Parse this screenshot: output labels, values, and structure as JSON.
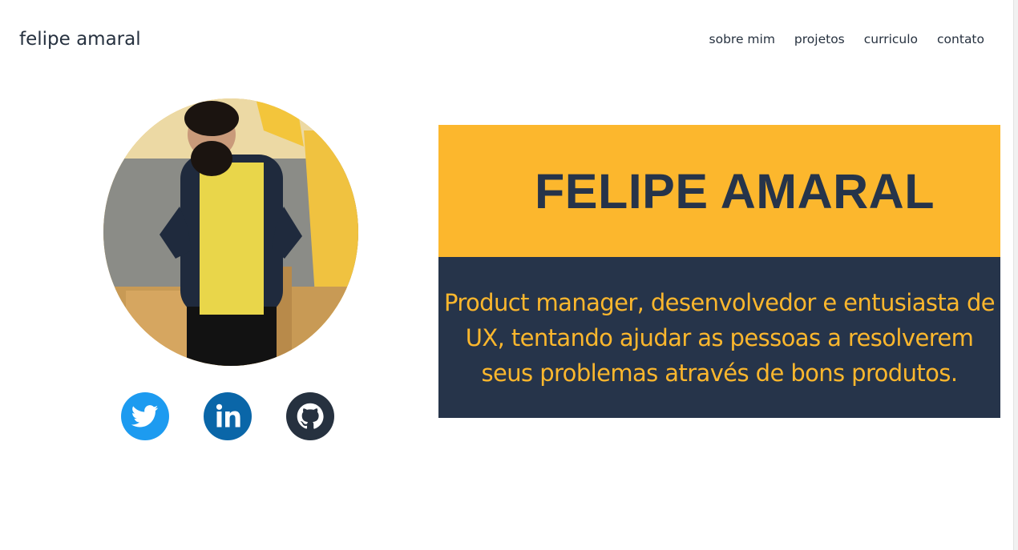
{
  "header": {
    "brand": "felipe amaral",
    "nav": [
      "sobre mim",
      "projetos",
      "curriculo",
      "contato"
    ]
  },
  "hero": {
    "name": "FELIPE AMARAL",
    "bio": "Product manager, desenvolvedor e entusiasta de UX, tentando ajudar as pessoas a resolverem seus problemas através de bons produtos."
  },
  "social": [
    {
      "name": "twitter",
      "icon": "twitter-icon",
      "color": "#1d9bf0"
    },
    {
      "name": "linkedin",
      "icon": "linkedin-icon",
      "color": "#0a66a8"
    },
    {
      "name": "github",
      "icon": "github-icon",
      "color": "#26313f"
    }
  ],
  "colors": {
    "accent": "#fcb72d",
    "dark": "#26344a",
    "text": "#26313f"
  }
}
